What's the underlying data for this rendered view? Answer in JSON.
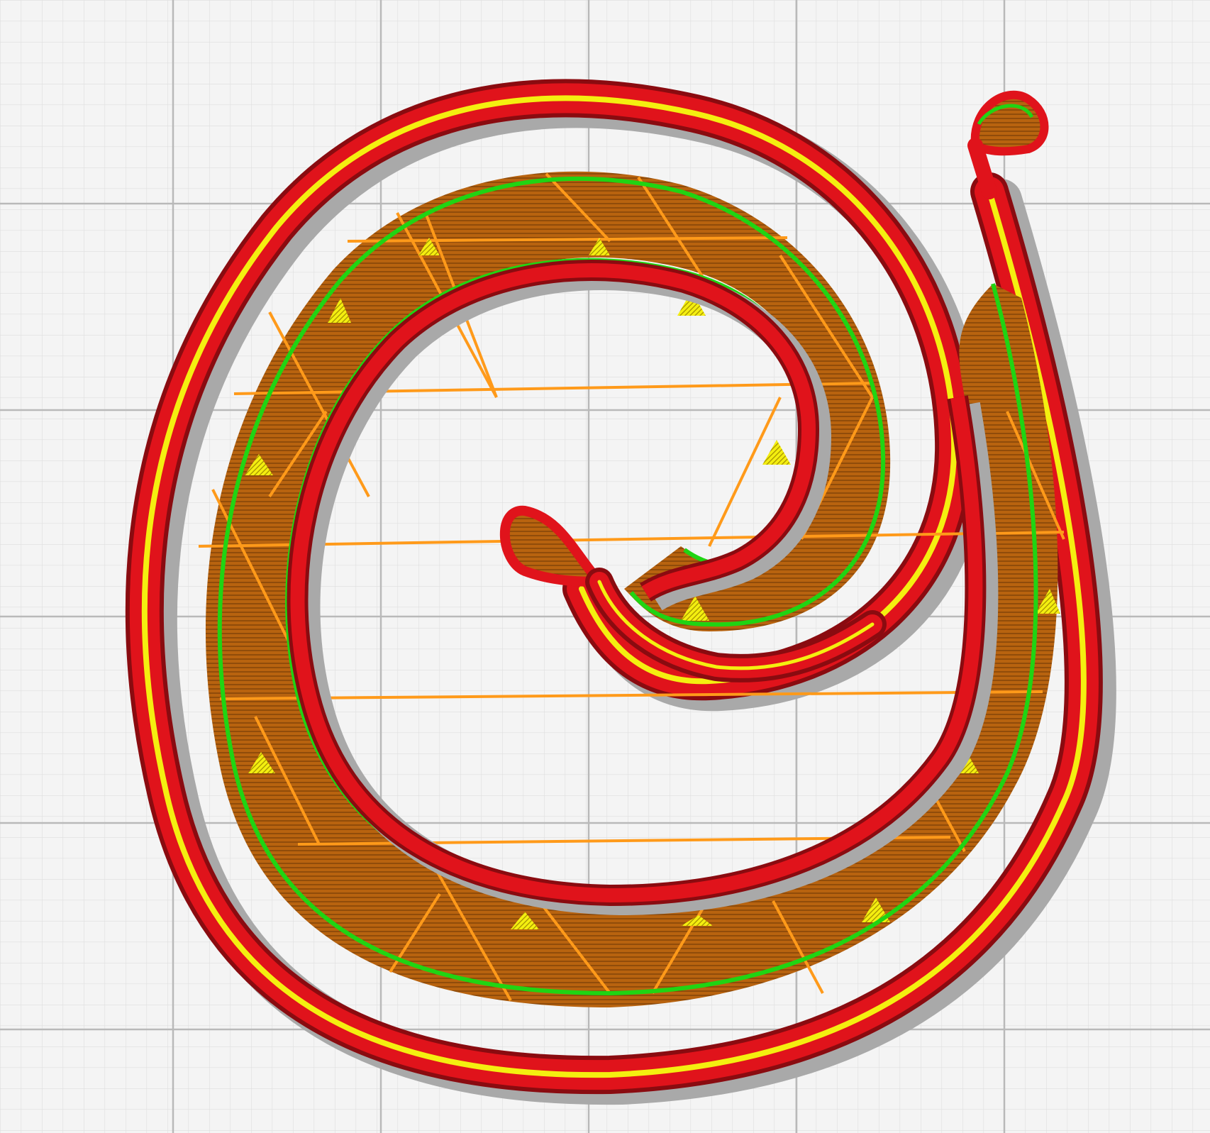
{
  "view": {
    "mode": "layer-preview",
    "content": "spiral-slice"
  },
  "legend_colors": {
    "background": "#f4f4f4",
    "grid_minor": "#dedede",
    "grid_major": "#b9b9b9",
    "shadow": "#a9a9a9",
    "outer_wall": "#e0131b",
    "outer_wall_dark": "#8a0b10",
    "inner_wall": "#20d413",
    "skin": "#f4ef10",
    "infill": "#b8630f",
    "infill_line": "#ff9a1a",
    "support_hatch": "#e6e600"
  },
  "icons": [
    "spiral-path-icon",
    "infill-hatch-icon",
    "support-marker-icon"
  ]
}
